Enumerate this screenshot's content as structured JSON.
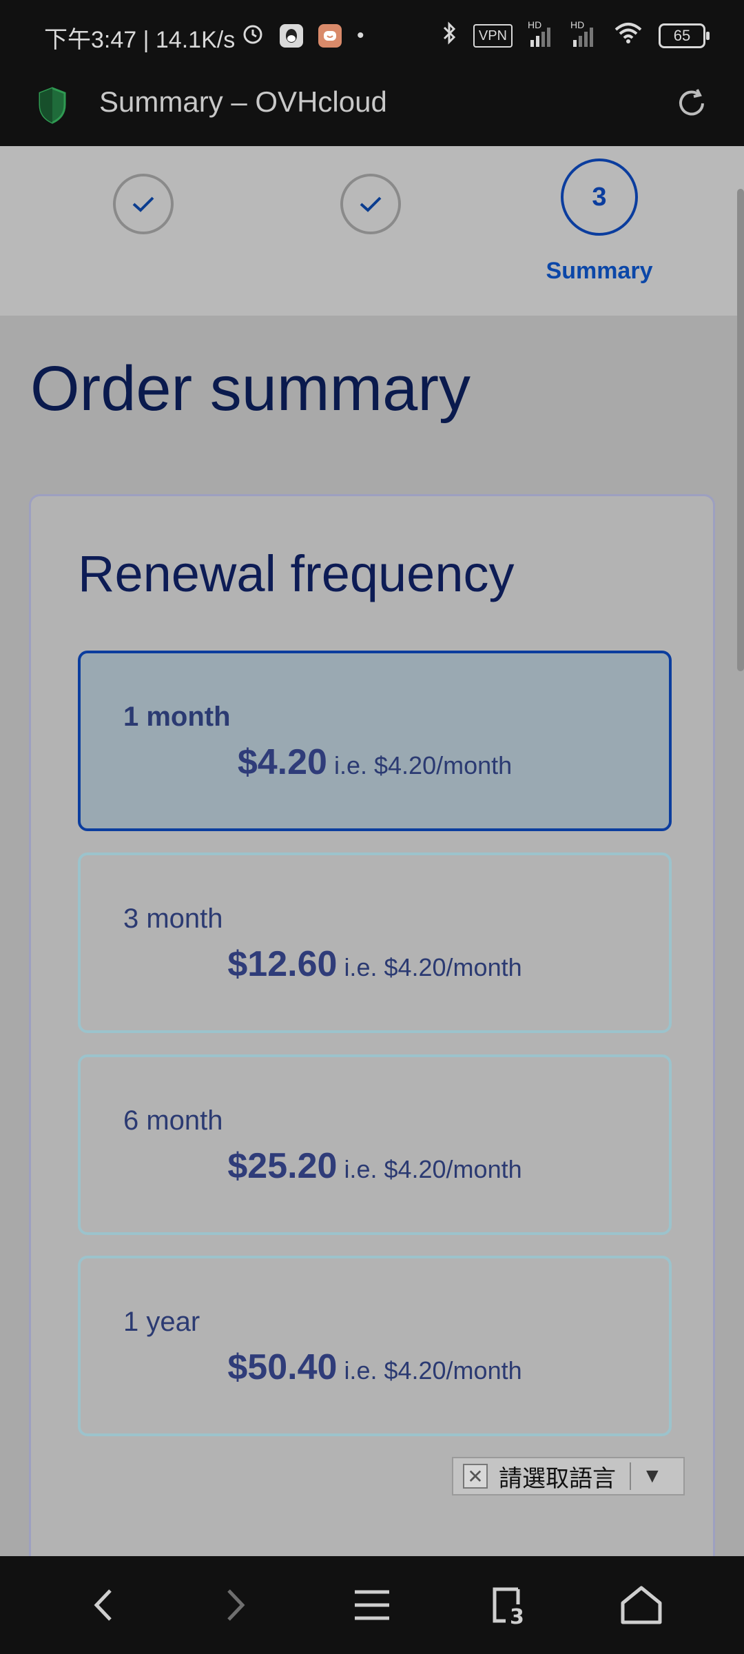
{
  "status_bar": {
    "time_speed": "下午3:47 | 14.1K/s",
    "vpn": "VPN",
    "signal_hd_1": "HD",
    "signal_hd_2": "HD",
    "battery": "65"
  },
  "browser": {
    "page_title": "Summary – OVHcloud"
  },
  "stepper": {
    "steps": [
      {
        "state": "done"
      },
      {
        "state": "done"
      },
      {
        "number": "3",
        "label": "Summary",
        "state": "active"
      }
    ]
  },
  "main": {
    "title": "Order summary",
    "renewal": {
      "title": "Renewal frequency",
      "options": [
        {
          "label": "1 month",
          "price": "$4.20",
          "per": "i.e. $4.20/month",
          "selected": true
        },
        {
          "label": "3 month",
          "price": "$12.60",
          "per": "i.e. $4.20/month",
          "selected": false
        },
        {
          "label": "6 month",
          "price": "$25.20",
          "per": "i.e. $4.20/month",
          "selected": false
        },
        {
          "label": "1 year",
          "price": "$50.40",
          "per": "i.e. $4.20/month",
          "selected": false
        }
      ]
    }
  },
  "language_widget": {
    "label": "請選取語言"
  },
  "colors": {
    "accent": "#0b3d9e",
    "header_bg": "#111111",
    "title_text": "#0a1a4d",
    "option_border": "#9cc3cc"
  }
}
